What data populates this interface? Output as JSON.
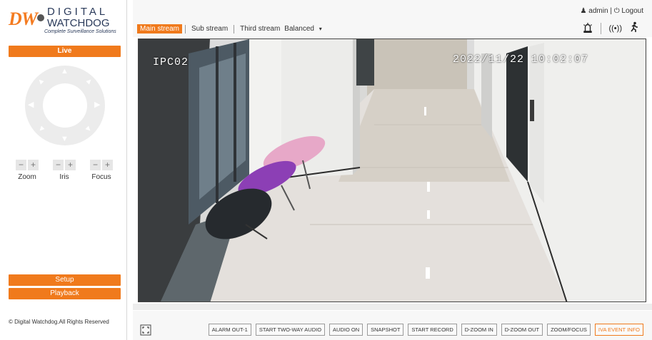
{
  "logo": {
    "brand_mark": "DW",
    "line1": "DIGITAL",
    "line2": "WATCHDOG",
    "tagline": "Complete Surveillance Solutions"
  },
  "sidebar": {
    "live_label": "Live",
    "controls": [
      {
        "label": "Zoom",
        "minus": "−",
        "plus": "+"
      },
      {
        "label": "Iris",
        "minus": "−",
        "plus": "+"
      },
      {
        "label": "Focus",
        "minus": "−",
        "plus": "+"
      }
    ],
    "setup_label": "Setup",
    "playback_label": "Playback",
    "copyright": "© Digital Watchdog.All Rights Reserved"
  },
  "header": {
    "user": "admin",
    "logout": "Logout",
    "tabs": [
      "Main stream",
      "Sub stream",
      "Third stream"
    ],
    "active_tab": 0,
    "stream_mode": "Balanced"
  },
  "video": {
    "camera_name": "IPC02",
    "timestamp": "2022/11/22 10:02:07"
  },
  "toolbar": {
    "buttons": [
      "ALARM OUT-1",
      "START TWO-WAY AUDIO",
      "AUDIO ON",
      "SNAPSHOT",
      "START RECORD",
      "D-ZOOM IN",
      "D-ZOOM OUT",
      "ZOOM/FOCUS",
      "IVA EVENT INFO"
    ]
  },
  "colors": {
    "accent": "#f07a1c",
    "brand_blue": "#2a3a5a"
  },
  "icons": [
    "user-icon",
    "power-icon",
    "alarm-icon",
    "audio-wave-icon",
    "motion-person-icon",
    "fullscreen-icon",
    "ptz-up-icon",
    "ptz-down-icon",
    "ptz-left-icon",
    "ptz-right-icon",
    "ptz-up-left-icon",
    "ptz-up-right-icon",
    "ptz-down-left-icon",
    "ptz-down-right-icon",
    "chevron-down-icon"
  ]
}
